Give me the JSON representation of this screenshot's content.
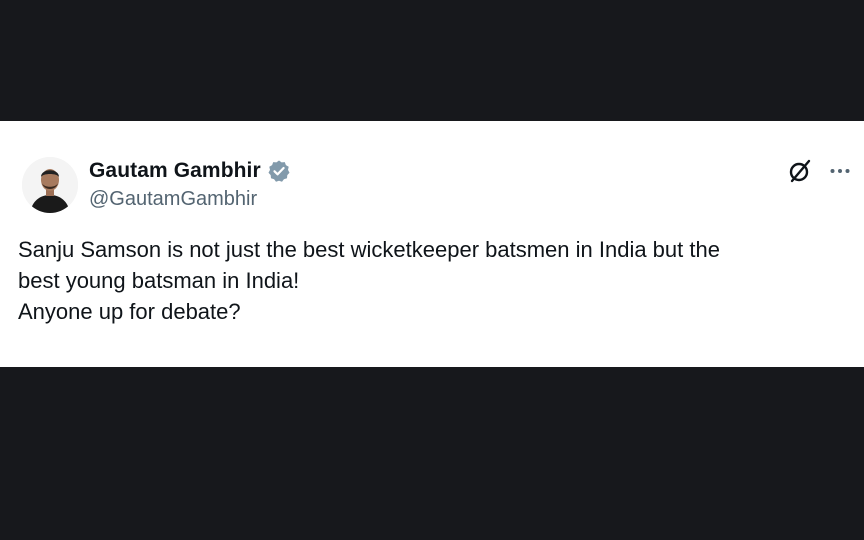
{
  "author": {
    "display_name": "Gautam Gambhir",
    "handle": "@GautamGambhir",
    "verified": true,
    "verified_color": "#829aab"
  },
  "tweet": {
    "lines": [
      "Sanju Samson is not just the best wicketkeeper batsmen in India but the",
      "best young batsman in India!",
      "Anyone up for debate?"
    ]
  },
  "icons": {
    "avatar": "profile-photo",
    "grok": "grok-icon",
    "more": "more-horizontal-icon"
  },
  "colors": {
    "background": "#17181c",
    "card": "#ffffff",
    "text_primary": "#0f1419",
    "text_secondary": "#536471"
  }
}
